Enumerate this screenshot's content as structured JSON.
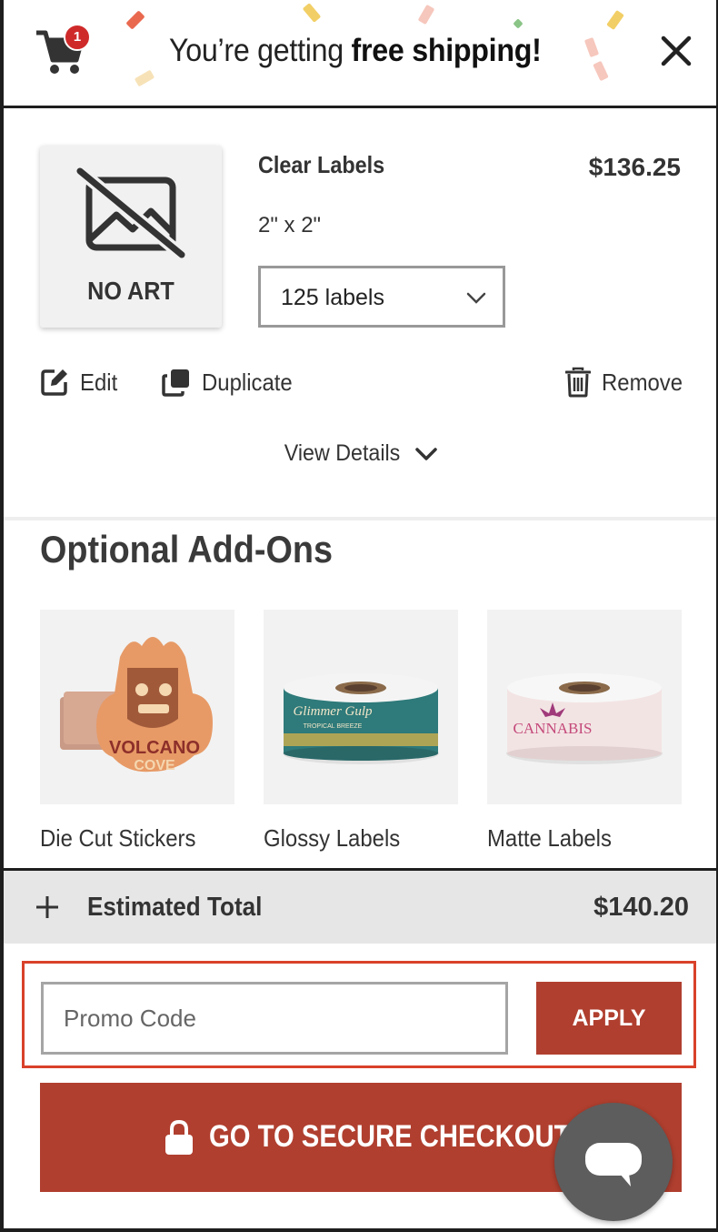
{
  "header": {
    "cart_count": "1",
    "message_prefix": "You’re getting ",
    "message_bold": "free shipping!",
    "icons": {
      "cart": "shopping-cart-icon",
      "close": "close-icon"
    }
  },
  "item": {
    "thumbnail_text": "NO ART",
    "title": "Clear Labels",
    "size": "2\" x 2\"",
    "price": "$136.25",
    "quantity_selected": "125 labels",
    "actions": {
      "edit": "Edit",
      "duplicate": "Duplicate",
      "remove": "Remove"
    },
    "view_details": "View Details"
  },
  "addons": {
    "title": "Optional Add-Ons",
    "items": [
      {
        "label": "Die Cut Stickers",
        "art_text_1": "VOLCANO",
        "art_text_2": "COVE"
      },
      {
        "label": "Glossy Labels",
        "art_text_1": "Glimmer Gulp",
        "art_text_2": "TROPICAL BREEZE"
      },
      {
        "label": "Matte Labels",
        "art_text_1": "CANNABIS",
        "art_text_2": ""
      }
    ]
  },
  "summary": {
    "label": "Estimated Total",
    "value": "$140.20"
  },
  "promo": {
    "placeholder": "Promo Code",
    "value": "",
    "apply_label": "APPLY"
  },
  "checkout": {
    "label": "GO TO SECURE CHECKOUT"
  },
  "colors": {
    "accent": "#b03f2f",
    "badge": "#cf2a2a",
    "promo_outline": "#d9412a",
    "text": "#333333",
    "total_bar": "#e6e6e6",
    "chat": "#5d5d5d"
  }
}
